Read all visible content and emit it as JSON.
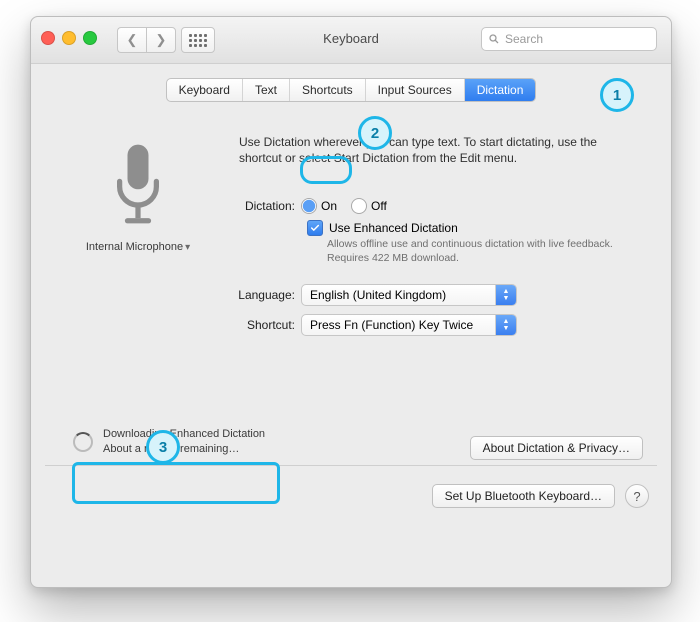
{
  "window": {
    "title": "Keyboard"
  },
  "search": {
    "placeholder": "Search"
  },
  "tabs": [
    "Keyboard",
    "Text",
    "Shortcuts",
    "Input Sources",
    "Dictation"
  ],
  "active_tab": "Dictation",
  "mic": {
    "device": "Internal Microphone"
  },
  "description": "Use Dictation wherever you can type text. To start dictating, use the shortcut or select Start Dictation from the Edit menu.",
  "dictation": {
    "label": "Dictation:",
    "state": "On",
    "on_label": "On",
    "off_label": "Off",
    "enhanced_checked": true,
    "enhanced_label": "Use Enhanced Dictation",
    "enhanced_sub": "Allows offline use and continuous dictation with live feedback. Requires 422 MB download."
  },
  "language": {
    "label": "Language:",
    "value": "English (United Kingdom)"
  },
  "shortcut": {
    "label": "Shortcut:",
    "value": "Press Fn (Function) Key Twice"
  },
  "download": {
    "line1": "Downloading Enhanced Dictation",
    "line2": "About a minute remaining…"
  },
  "buttons": {
    "about": "About Dictation & Privacy…",
    "bluetooth": "Set Up Bluetooth Keyboard…"
  },
  "annotations": {
    "n1": "1",
    "n2": "2",
    "n3": "3"
  }
}
